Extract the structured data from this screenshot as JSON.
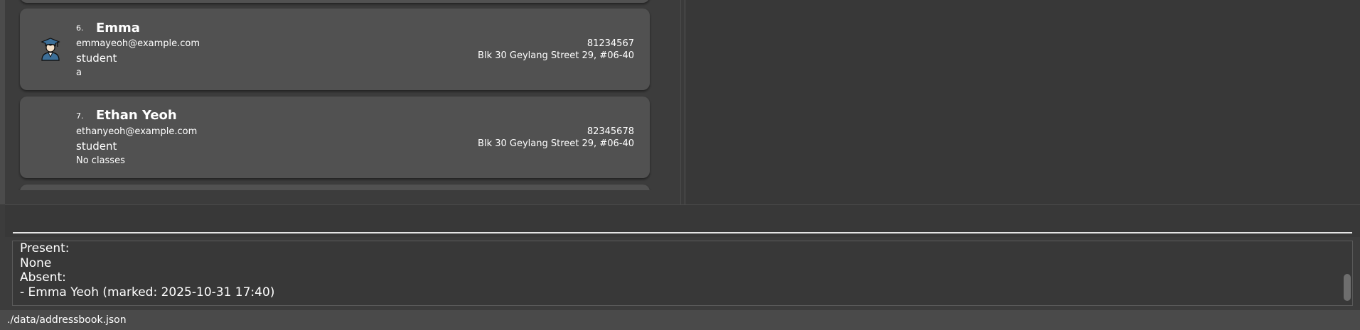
{
  "persons": [
    {
      "index": "6.",
      "name": "Emma",
      "email": "emmayeoh@example.com",
      "role": "student",
      "extra": "a",
      "phone": "81234567",
      "address": "Blk 30 Geylang Street 29, #06-40",
      "avatar_icon": "student-graduate-icon"
    },
    {
      "index": "7.",
      "name": "Ethan Yeoh",
      "email": "ethanyeoh@example.com",
      "role": "student",
      "extra": "No classes",
      "phone": "82345678",
      "address": "Blk 30 Geylang Street 29, #06-40",
      "avatar_icon": "student-graduate-icon"
    }
  ],
  "command": {
    "value": ""
  },
  "result": {
    "lines": [
      "Present:",
      "None",
      "Absent:",
      "- Emma Yeoh (marked: 2025-10-31 17:40)"
    ]
  },
  "status_bar": {
    "path": "./data/addressbook.json"
  },
  "colors": {
    "background": "#3c3c3c",
    "card": "#515151",
    "text": "#ffffff"
  }
}
